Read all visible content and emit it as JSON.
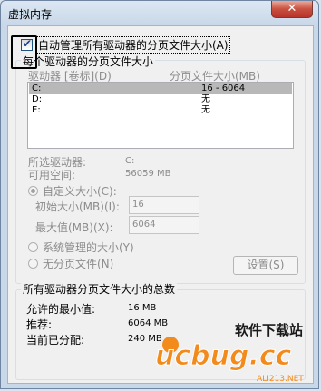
{
  "window": {
    "title": "虚拟内存",
    "close_glyph": "✕"
  },
  "auto_manage": {
    "label": "自动管理所有驱动器的分页文件大小(A)",
    "checked": true
  },
  "drive_group": {
    "legend": "每个驱动器的分页文件大小",
    "col_drive": "驱动器 [卷标](D)",
    "col_size": "分页文件大小(MB)",
    "drives": [
      {
        "letter": "C:",
        "size": "16 - 6064",
        "selected": true
      },
      {
        "letter": "D:",
        "size": "无",
        "selected": false
      },
      {
        "letter": "E:",
        "size": "无",
        "selected": false
      }
    ],
    "selected_drive_label": "所选驱动器:",
    "selected_drive_value": "C:",
    "available_space_label": "可用空间:",
    "available_space_value": "56059 MB",
    "custom_size_label": "自定义大小(C):",
    "initial_size_label": "初始大小(MB)(I):",
    "initial_size_value": "16",
    "max_size_label": "最大值(MB)(X):",
    "max_size_value": "6064",
    "system_managed_label": "系统管理的大小(Y)",
    "no_paging_label": "无分页文件(N)",
    "set_button": "设置(S)"
  },
  "total_group": {
    "legend": "所有驱动器分页文件大小的总数",
    "min_allowed_label": "允许的最小值:",
    "min_allowed_value": "16 MB",
    "recommended_label": "推荐:",
    "recommended_value": "6064 MB",
    "current_label": "当前已分配:",
    "current_value": "240 MB"
  },
  "watermark": {
    "logo": "ucbug.cc",
    "tagline": "软件下载站",
    "domain": "ALI213.NET"
  },
  "colors": {
    "window_frame": "#c9d8e9",
    "close_button": "#c9503f",
    "selection": "#b8b8b8",
    "watermark_orange": "#f28a1c"
  }
}
